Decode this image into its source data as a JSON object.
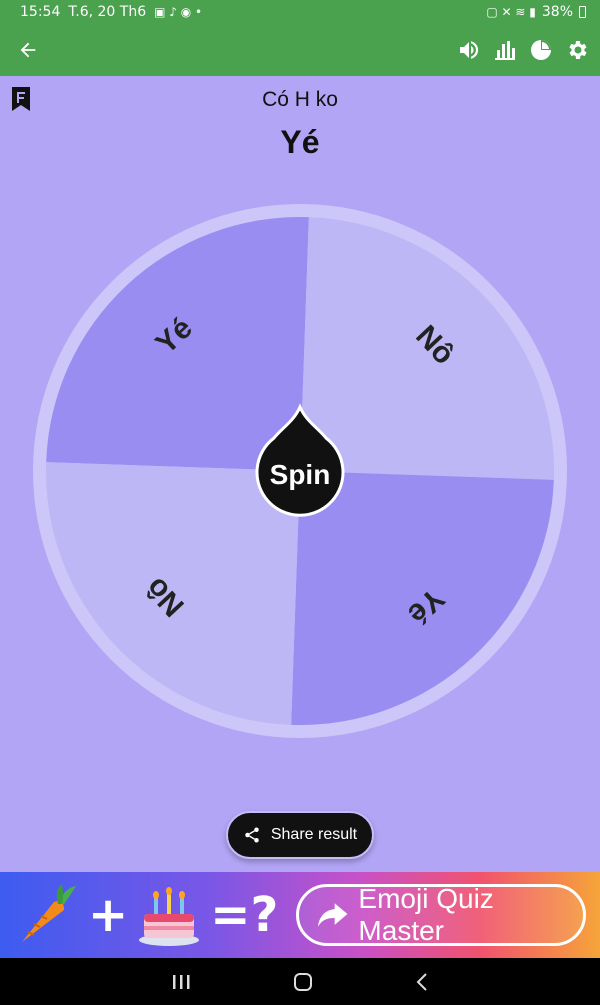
{
  "status": {
    "time": "15:54",
    "date": "T.6, 20 Th6",
    "battery": "38%"
  },
  "app_bar": {
    "back_icon": "arrow-left-icon",
    "action_icons": [
      "volume-icon",
      "bar-chart-icon",
      "pie-chart-icon",
      "gear-icon"
    ]
  },
  "wheel": {
    "title": "Có H ko",
    "result": "Yé",
    "spin_label": "Spin",
    "segments": [
      {
        "label": "Yé",
        "color": "#9a8df2"
      },
      {
        "label": "Nô",
        "color": "#bdb7f5"
      },
      {
        "label": "Yé",
        "color": "#9a8df2"
      },
      {
        "label": "Nô",
        "color": "#bdb7f5"
      }
    ]
  },
  "share": {
    "label": "Share result",
    "icon": "share-icon"
  },
  "ad": {
    "plus": "+",
    "equals": "=?",
    "cta": "Emoji Quiz Master",
    "icons": [
      "carrot-icon",
      "cake-icon",
      "share-arrow-icon"
    ]
  },
  "colors": {
    "app_bar": "#4aa14e",
    "background": "#b3a5f6",
    "segment_dark": "#9a8df2",
    "segment_light": "#bdb7f5"
  }
}
